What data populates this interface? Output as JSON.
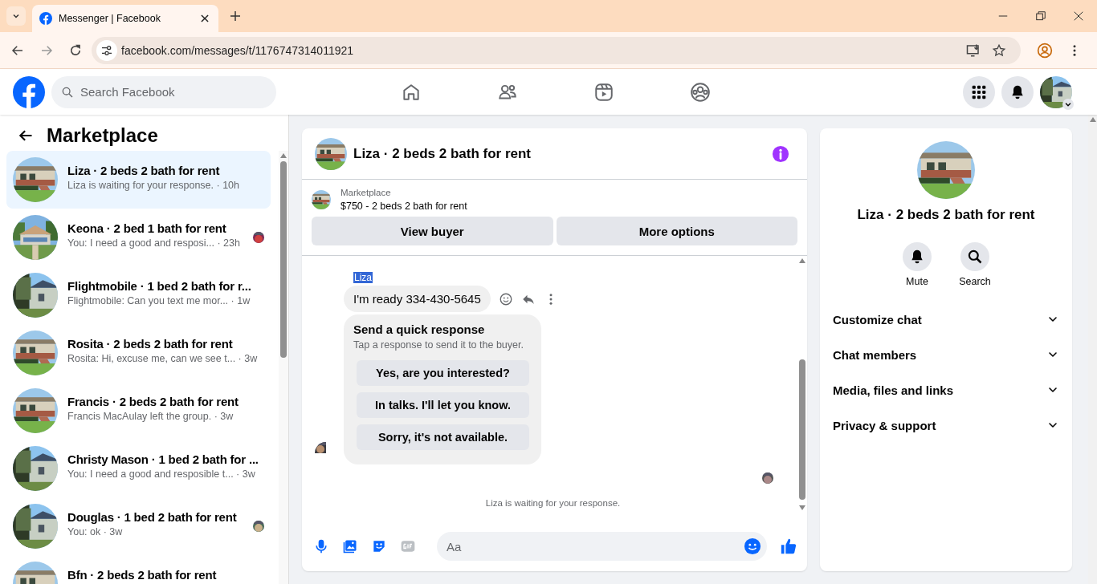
{
  "browser": {
    "tab_title": "Messenger | Facebook",
    "url": "facebook.com/messages/t/1176747314011921"
  },
  "header": {
    "search_placeholder": "Search Facebook"
  },
  "sidebar": {
    "title": "Marketplace",
    "conversations": [
      {
        "title": "Liza · 2 beds 2 bath for rent",
        "preview": "Liza is waiting for your response. · 10h",
        "selected": true,
        "seen": false
      },
      {
        "title": "Keona · 2 bed 1 bath for rent",
        "preview": "You: I need a good and resposi... · 23h",
        "selected": false,
        "seen": true
      },
      {
        "title": "Flightmobile · 1 bed 2 bath for r...",
        "preview": "Flightmobile: Can you text me mor... · 1w",
        "selected": false,
        "seen": false
      },
      {
        "title": "Rosita · 2 beds 2 bath for rent",
        "preview": "Rosita: Hi, excuse me, can we see t... · 3w",
        "selected": false,
        "seen": false
      },
      {
        "title": "Francis · 2 beds 2 bath for rent",
        "preview": "Francis MacAulay left the group. · 3w",
        "selected": false,
        "seen": false
      },
      {
        "title": "Christy Mason · 1 bed 2 bath for ...",
        "preview": "You: I need a good and resposible t... · 3w",
        "selected": false,
        "seen": false
      },
      {
        "title": "Douglas · 1 bed 2 bath for rent",
        "preview": "You: ok · 3w",
        "selected": false,
        "seen": true
      },
      {
        "title": "Bfn · 2 beds 2 bath for rent",
        "selected": false,
        "seen": false
      }
    ]
  },
  "chat": {
    "title": "Liza · 2 beds 2 bath for rent",
    "listing": {
      "label": "Marketplace",
      "text": "$750 - 2 beds 2 bath for rent"
    },
    "buttons": [
      "View buyer",
      "More options"
    ],
    "message": {
      "sender": "Liza",
      "sender_highlighted": true,
      "text": "I'm ready 334-430-5645"
    },
    "quick_response": {
      "title": "Send a quick response",
      "subtitle": "Tap a response to send it to the buyer.",
      "options": [
        "Yes, are you interested?",
        "In talks. I'll let you know.",
        "Sorry, it's not available."
      ]
    },
    "status": "Liza is waiting for your response.",
    "composer": {
      "placeholder": "Aa"
    }
  },
  "details": {
    "title": "Liza · 2 beds 2 bath for rent",
    "actions": [
      {
        "kind": "bell",
        "label": "Mute"
      },
      {
        "kind": "search",
        "label": "Search"
      }
    ],
    "sections": [
      {
        "label": "Customize chat",
        "expanded": false
      },
      {
        "label": "Chat members",
        "expanded": false
      },
      {
        "label": "Media, files and links",
        "expanded": false
      },
      {
        "label": "Privacy & support",
        "expanded": false
      }
    ]
  }
}
